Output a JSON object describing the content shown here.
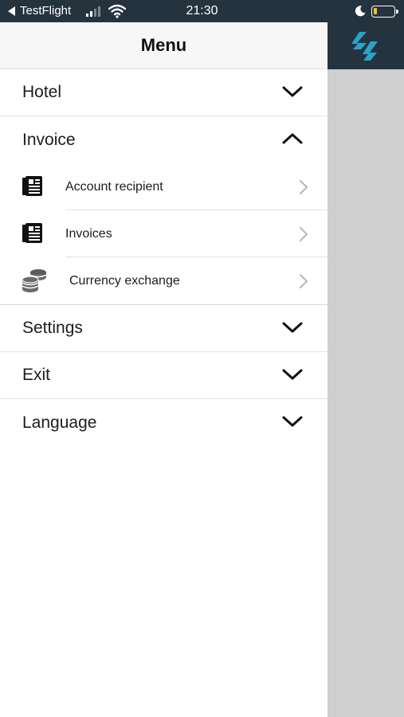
{
  "status_bar": {
    "back_label": "TestFlight",
    "time": "21:30"
  },
  "menu": {
    "title": "Menu",
    "sections": [
      {
        "label": "Hotel",
        "expanded": false
      },
      {
        "label": "Invoice",
        "expanded": true
      },
      {
        "label": "Settings",
        "expanded": false
      },
      {
        "label": "Exit",
        "expanded": false
      },
      {
        "label": "Language",
        "expanded": false
      }
    ],
    "invoice_items": [
      {
        "label": "Account recipient",
        "icon": "document-icon"
      },
      {
        "label": "Invoices",
        "icon": "document-icon"
      },
      {
        "label": "Currency exchange",
        "icon": "coins-icon"
      }
    ]
  },
  "colors": {
    "header_dark": "#25333f",
    "accent_logo": "#2aa3c9",
    "overlay": "#cfcfcf"
  }
}
